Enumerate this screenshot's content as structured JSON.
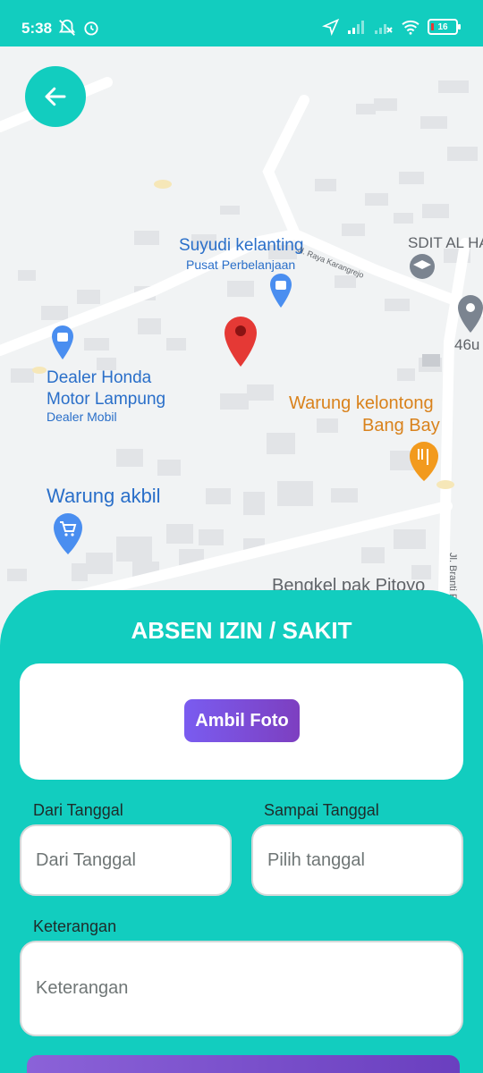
{
  "status_bar": {
    "time": "5:38",
    "battery": "16",
    "icons": [
      "muted-bell-icon",
      "alarm-icon",
      "location-arrow-icon",
      "signal-icon",
      "signal-off-icon",
      "wifi-icon",
      "battery-icon"
    ]
  },
  "map": {
    "places": {
      "suyudi_name": "Suyudi kelanting",
      "suyudi_type": "Pusat Perbelanjaan",
      "sdit": "SDIT AL HA",
      "road_karangrejo": "Jl. Raya Karangrejo",
      "dealer_line1": "Dealer Honda",
      "dealer_line2": "Motor Lampung",
      "dealer_type": "Dealer Mobil",
      "number_46u": "46u",
      "warung_kelontong_line1": "Warung kelontong",
      "warung_kelontong_line2": "Bang Bay",
      "warung_akbil": "Warung akbil",
      "bengkel": "Bengkel pak Pitoyo",
      "road_branti": "Jl. Branti R"
    },
    "colors": {
      "blue_label": "#2a6fc9",
      "orange_label": "#d9821c",
      "marker_red": "#e53935"
    }
  },
  "form": {
    "title": "ABSEN IZIN / SAKIT",
    "photo_button": "Ambil Foto",
    "from_label": "Dari Tanggal",
    "from_placeholder": "Dari Tanggal",
    "to_label": "Sampai Tanggal",
    "to_placeholder": "Pilih tanggal",
    "note_label": "Keterangan",
    "note_placeholder": "Keterangan"
  },
  "theme": {
    "primary": "#12cdbf",
    "button_gradient": [
      "#7a5cf0",
      "#7d3fc0"
    ]
  }
}
